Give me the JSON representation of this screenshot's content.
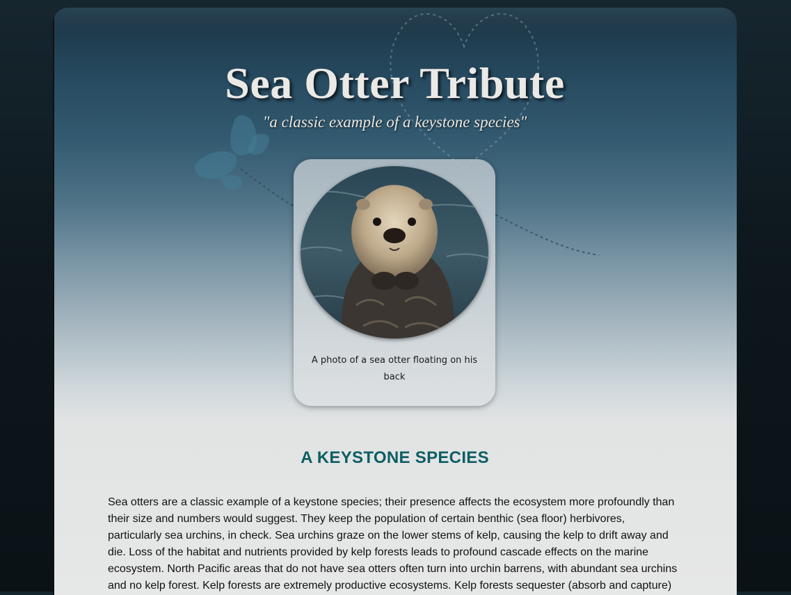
{
  "header": {
    "title": "Sea Otter Tribute",
    "tagline": "\"a classic example of a keystone species\""
  },
  "figure": {
    "caption": "A photo of a sea otter floating on his back"
  },
  "section": {
    "heading": "A KEYSTONE SPECIES",
    "body": "Sea otters are a classic example of a keystone species; their presence affects the ecosystem more profoundly than their size and numbers would suggest. They keep the population of certain benthic (sea floor) herbivores, particularly sea urchins, in check. Sea urchins graze on the lower stems of kelp, causing the kelp to drift away and die. Loss of the habitat and nutrients provided by kelp forests leads to profound cascade effects on the marine ecosystem. North Pacific areas that do not have sea otters often turn into urchin barrens, with abundant sea urchins and no kelp forest. Kelp forests are extremely productive ecosystems. Kelp forests sequester (absorb and capture)"
  },
  "colors": {
    "heading_accent": "#0e5e63",
    "title_text": "#ebe9e6"
  },
  "icons": [
    "heart-outline-icon",
    "butterfly-icon",
    "dotted-flight-path-icon"
  ]
}
